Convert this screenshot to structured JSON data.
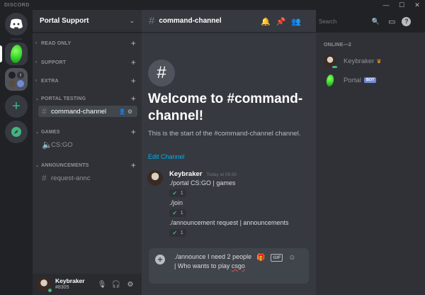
{
  "titlebar": {
    "app_name": "DISCORD"
  },
  "guild": {
    "name": "Portal Support",
    "categories": [
      {
        "label": "READ ONLY"
      },
      {
        "label": "SUPPORT"
      },
      {
        "label": "EXTRA"
      },
      {
        "label": "PORTAL TESTING"
      },
      {
        "label": "GAMES"
      },
      {
        "label": "ANNOUNCEMENTS"
      }
    ],
    "channels": {
      "command": "command-channel",
      "csgo": "CS:GO",
      "request": "request-annc"
    }
  },
  "user": {
    "name": "Keybraker",
    "tag": "#8305"
  },
  "chat": {
    "channel": "command-channel",
    "welcome_title": "Welcome to #command-channel!",
    "welcome_desc": "This is the start of the #command-channel channel.",
    "edit_link": "Edit Channel",
    "message": {
      "author": "Keybraker",
      "timestamp": "Today at 09:30",
      "lines": [
        "./portal CS:GO | games",
        "./join",
        "./announcement request | announcements"
      ],
      "reaction_count": "1"
    },
    "composer_text": "./announce I need 2 people | Who wants to play ",
    "composer_text_misspelled": "csgo"
  },
  "search": {
    "placeholder": "Search"
  },
  "members": {
    "header": "ONLINE—2",
    "list": [
      {
        "name": "Keybraker",
        "crown": true
      },
      {
        "name": "Portal",
        "badge": "BOT"
      }
    ]
  },
  "colors": {
    "accent": "#7289da",
    "online": "#43b581",
    "link": "#00b0f4"
  }
}
